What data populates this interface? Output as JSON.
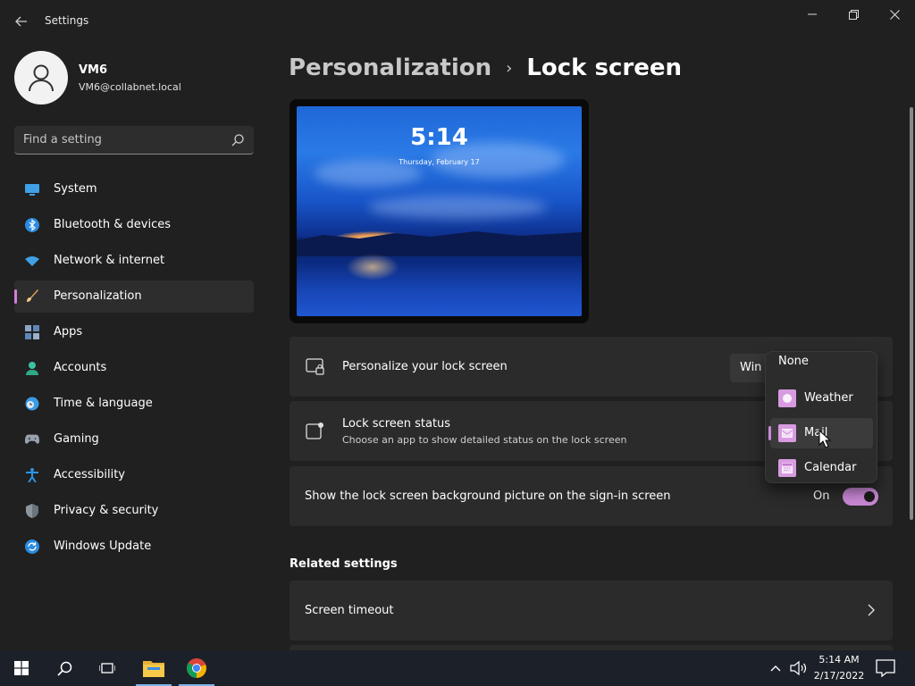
{
  "window": {
    "title": "Settings",
    "back_icon": "back-arrow-icon",
    "minimize_icon": "minimize-icon",
    "maximize_icon": "restore-icon",
    "close_icon": "close-icon"
  },
  "profile": {
    "name": "VM6",
    "email": "VM6@collabnet.local"
  },
  "search": {
    "placeholder": "Find a setting"
  },
  "sidebar": {
    "items": [
      {
        "label": "System",
        "icon": "system-icon"
      },
      {
        "label": "Bluetooth & devices",
        "icon": "bluetooth-icon"
      },
      {
        "label": "Network & internet",
        "icon": "wifi-icon"
      },
      {
        "label": "Personalization",
        "icon": "brush-icon",
        "active": true
      },
      {
        "label": "Apps",
        "icon": "apps-icon"
      },
      {
        "label": "Accounts",
        "icon": "accounts-icon"
      },
      {
        "label": "Time & language",
        "icon": "clock-globe-icon"
      },
      {
        "label": "Gaming",
        "icon": "gamepad-icon"
      },
      {
        "label": "Accessibility",
        "icon": "accessibility-icon"
      },
      {
        "label": "Privacy & security",
        "icon": "shield-icon"
      },
      {
        "label": "Windows Update",
        "icon": "update-icon"
      }
    ]
  },
  "breadcrumb": {
    "parent": "Personalization",
    "separator": "›",
    "current": "Lock screen"
  },
  "preview": {
    "time": "5:14",
    "date": "Thursday, February 17"
  },
  "settings": {
    "personalize": {
      "title": "Personalize your lock screen",
      "value": "Win"
    },
    "status": {
      "title": "Lock screen status",
      "subtitle": "Choose an app to show detailed status on the lock screen"
    },
    "signin": {
      "title": "Show the lock screen background picture on the sign-in screen",
      "state_label": "On",
      "on": true
    }
  },
  "related": {
    "heading": "Related settings",
    "items": [
      {
        "label": "Screen timeout"
      }
    ]
  },
  "dropdown": {
    "options": [
      {
        "label": "None"
      },
      {
        "label": "Weather",
        "icon": "weather-icon"
      },
      {
        "label": "Mail",
        "icon": "mail-icon",
        "selected": true
      },
      {
        "label": "Calendar",
        "icon": "calendar-icon"
      }
    ]
  },
  "taskbar": {
    "clock_time": "5:14 AM",
    "clock_date": "2/17/2022"
  },
  "colors": {
    "accent": "#c887d4",
    "background": "#202020",
    "card": "#2b2b2b",
    "taskbar": "#1c2129"
  }
}
